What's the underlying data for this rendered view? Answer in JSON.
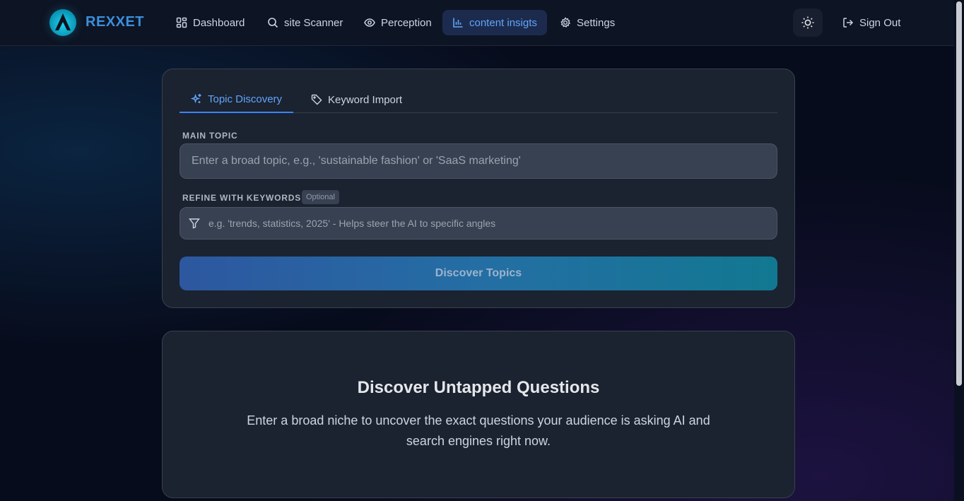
{
  "brand": {
    "name": "REXXET",
    "logo_icon": "logo-icon"
  },
  "nav": {
    "items": [
      {
        "label": "Dashboard",
        "icon": "grid-icon"
      },
      {
        "label": "site Scanner",
        "icon": "search-icon"
      },
      {
        "label": "Perception",
        "icon": "eye-icon"
      },
      {
        "label": "content insigts",
        "icon": "bar-chart-icon",
        "active": true
      },
      {
        "label": "Settings",
        "icon": "gear-icon"
      }
    ],
    "theme_toggle_icon": "sun-icon",
    "sign_out": {
      "label": "Sign Out",
      "icon": "log-out-icon"
    }
  },
  "tabs": [
    {
      "label": "Topic Discovery",
      "icon": "sparkles-icon",
      "active": true
    },
    {
      "label": "Keyword Import",
      "icon": "tag-icon"
    }
  ],
  "form": {
    "main_topic": {
      "label": "MAIN TOPIC",
      "placeholder": "Enter a broad topic, e.g., 'sustainable fashion' or 'SaaS marketing'",
      "value": ""
    },
    "keywords": {
      "label": "REFINE WITH KEYWORDS",
      "badge": "Optional",
      "placeholder": "e.g. 'trends, statistics, 2025' - Helps steer the AI to specific angles",
      "value": "",
      "icon": "filter-icon"
    },
    "submit_label": "Discover Topics"
  },
  "empty_state": {
    "title": "Discover Untapped Questions",
    "description": "Enter a broad niche to uncover the exact questions your audience is asking AI and search engines right now."
  },
  "colors": {
    "accent": "#3b82f6",
    "brand": "#3b8fdc",
    "background": "#070c1c",
    "card": "#1b2230"
  }
}
